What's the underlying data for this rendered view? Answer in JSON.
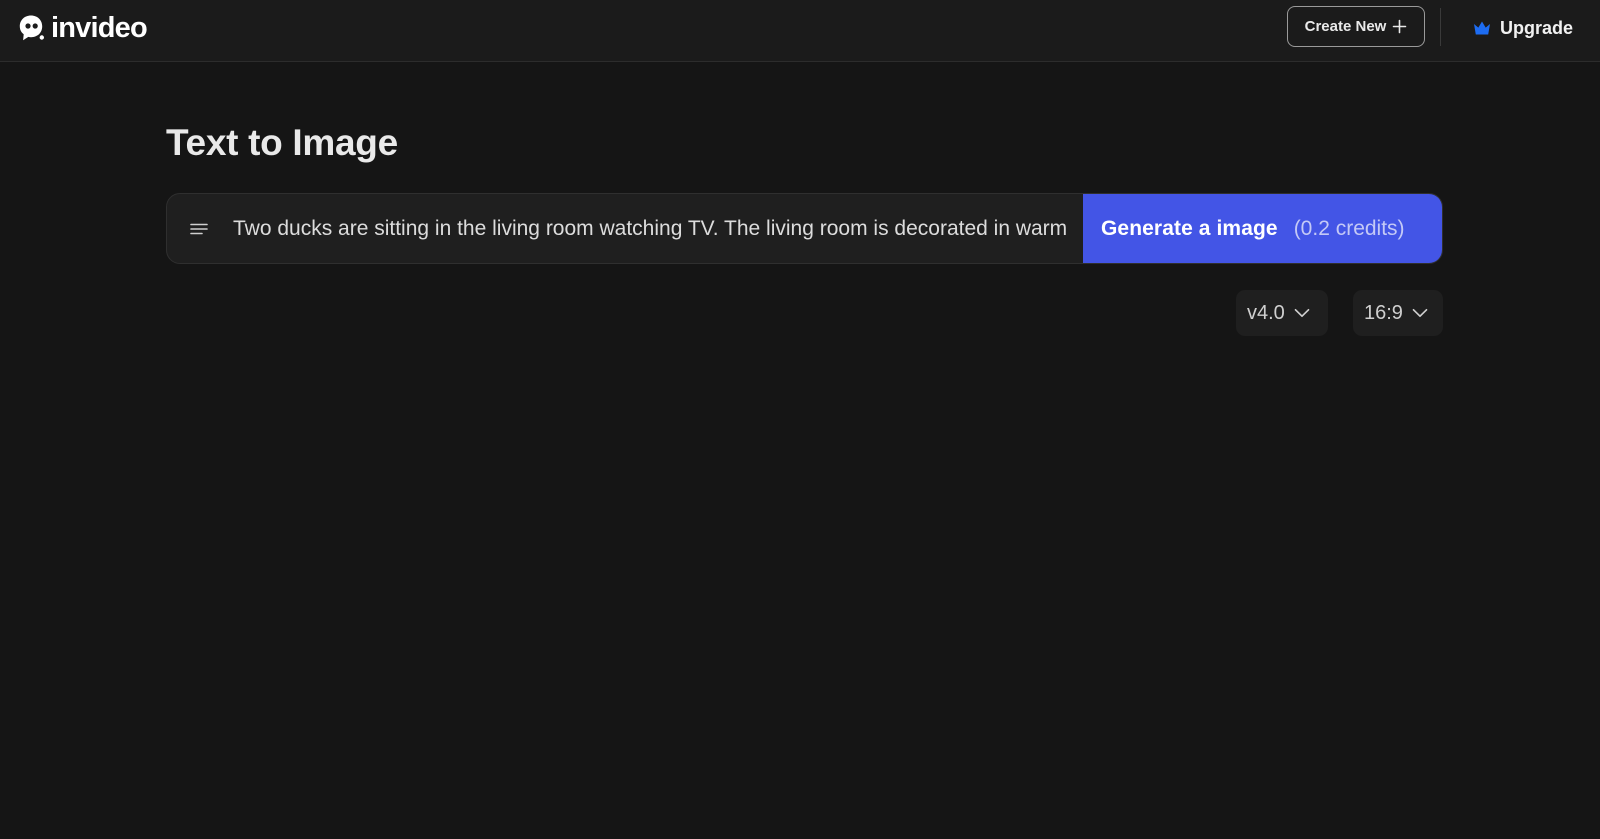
{
  "header": {
    "logo_text": "invideo",
    "create_new_label": "Create New",
    "upgrade_label": "Upgrade",
    "upgrade_icon_color": "#1d6cf2"
  },
  "main": {
    "title": "Text to Image",
    "prompt": {
      "value": "Two ducks are sitting in the living room watching TV. The living room is decorated in warm"
    },
    "generate_button": {
      "label": "Generate a image",
      "credits": "(0.2 credits)",
      "color": "#4355e6"
    },
    "model_version": "v4.0",
    "aspect_ratio": "16:9"
  },
  "icons": [
    "invideo-logo-icon",
    "plus-icon",
    "crown-icon",
    "text-lines-icon",
    "chevron-down-icon"
  ]
}
